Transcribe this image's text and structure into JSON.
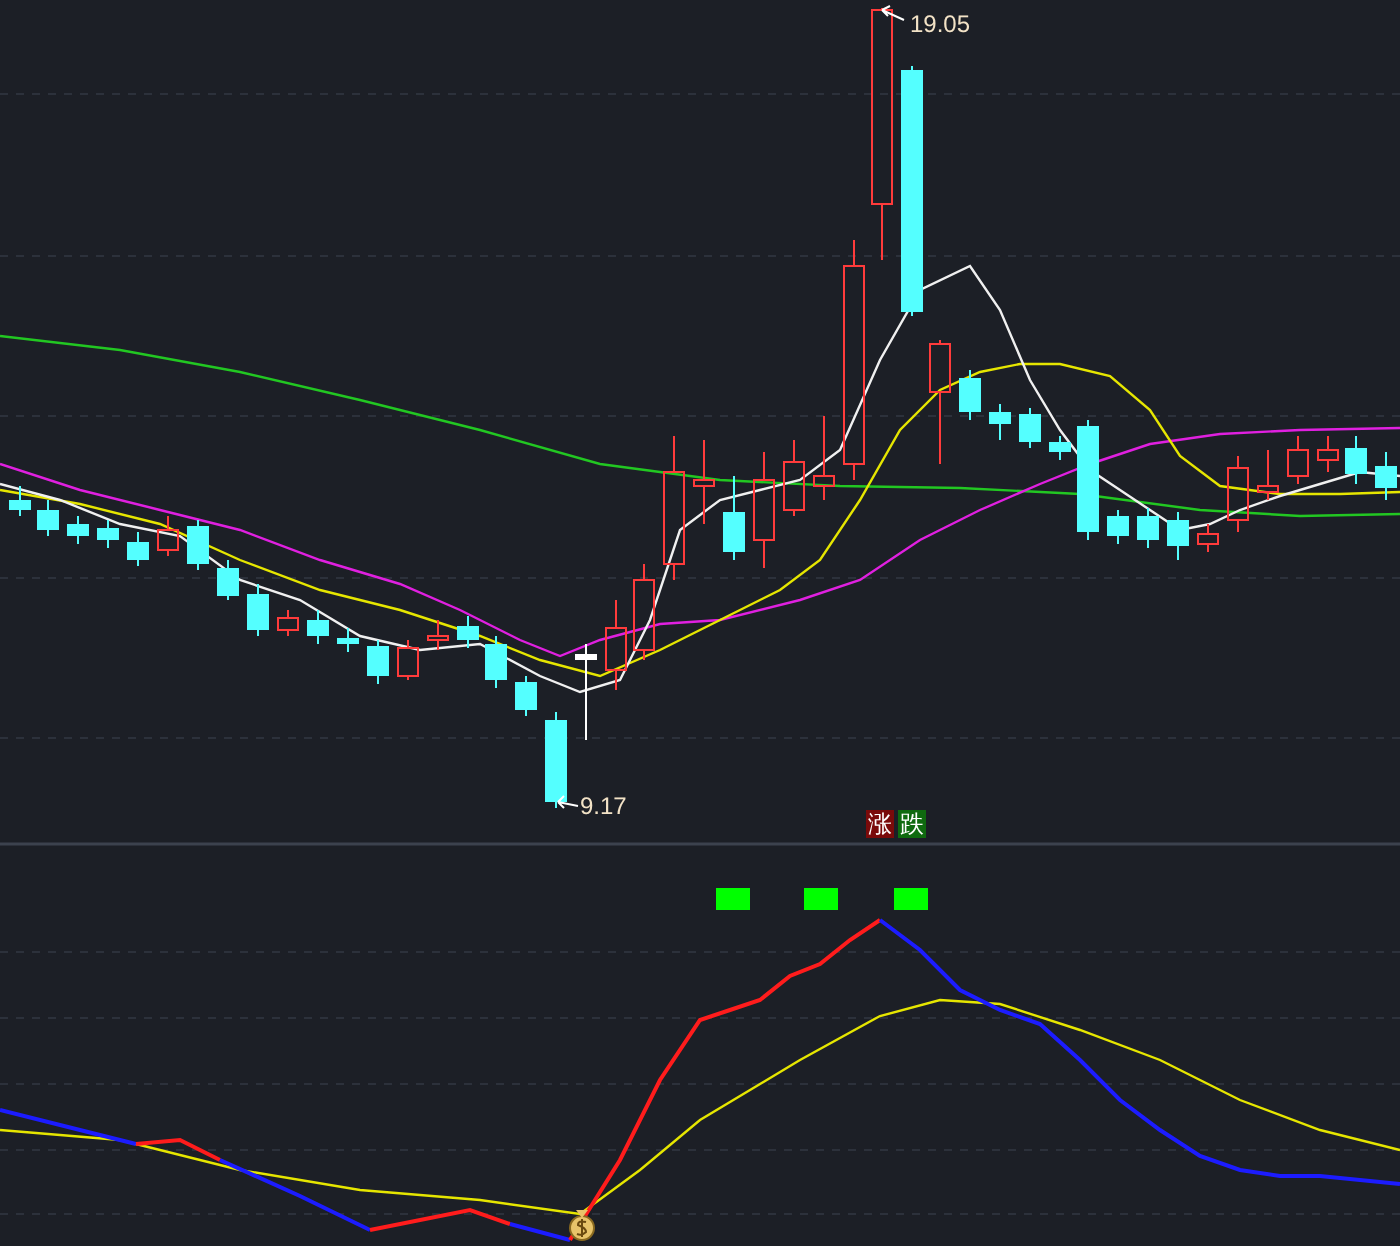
{
  "price_chart": {
    "high_label": "19.05",
    "low_label": "9.17"
  },
  "legend": [
    {
      "label": "涨",
      "kind": "up"
    },
    {
      "label": "跌",
      "kind": "down"
    }
  ]
}
